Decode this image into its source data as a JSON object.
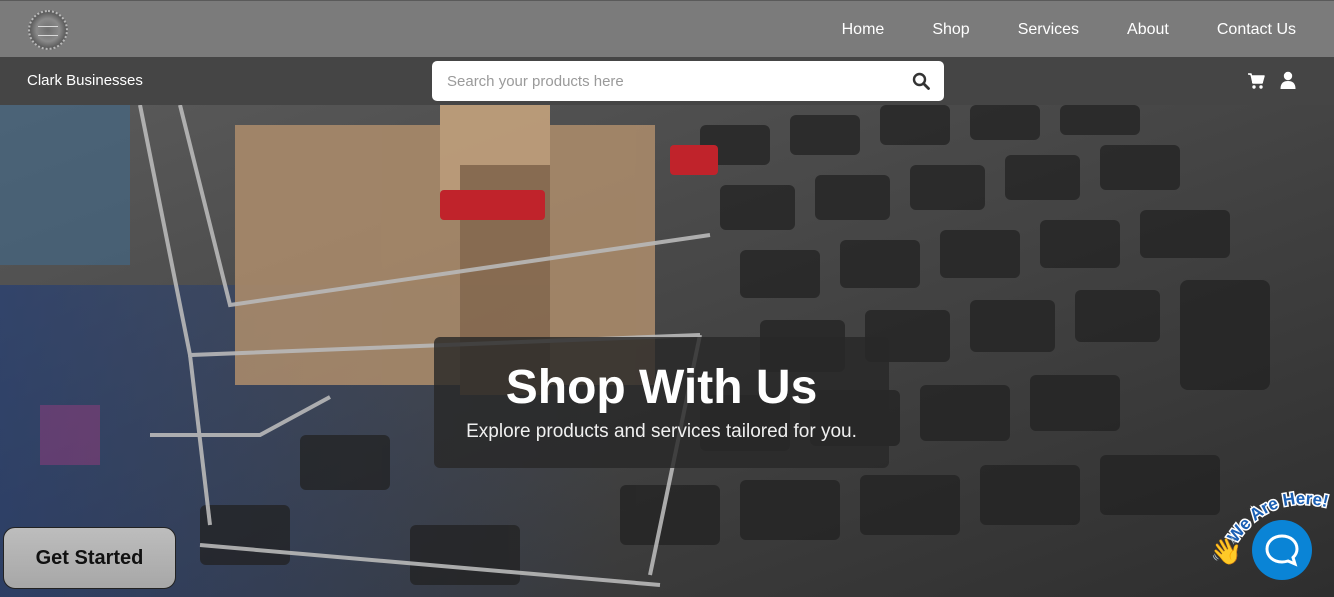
{
  "topbar": {
    "logo_icon": "brand-logo-icon",
    "nav": [
      {
        "label": "Home"
      },
      {
        "label": "Shop"
      },
      {
        "label": "Services"
      },
      {
        "label": "About"
      },
      {
        "label": "Contact Us"
      }
    ]
  },
  "subbar": {
    "brand_name": "Clark Businesses",
    "search": {
      "placeholder": "Search your products here",
      "value": ""
    },
    "icons": {
      "search": "search-icon",
      "cart": "cart-icon",
      "user": "user-icon"
    }
  },
  "hero": {
    "title": "Shop With Us",
    "subtitle": "Explore products and services tailored for you.",
    "cta_label": "Get Started"
  },
  "chat": {
    "badge_text": "We Are Here!",
    "wave_icon": "waving-hand-icon",
    "button_icon": "chat-bubble-icon",
    "color": "#0a84d6"
  }
}
